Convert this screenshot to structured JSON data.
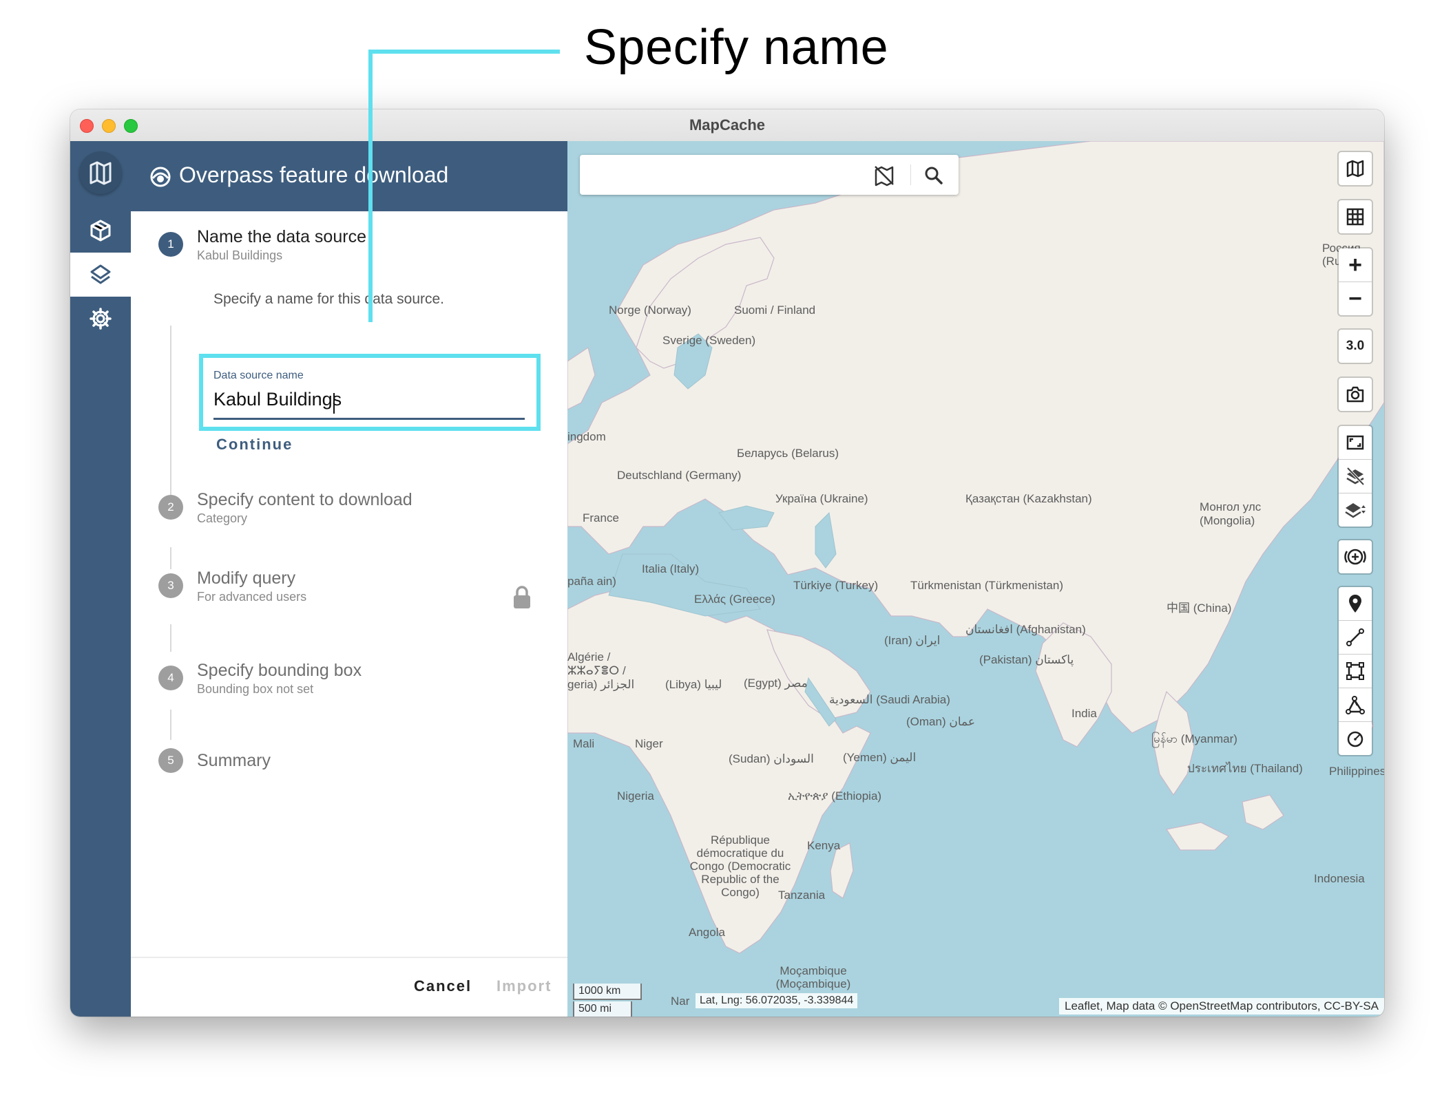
{
  "callout": {
    "text": "Specify name"
  },
  "window": {
    "title": "MapCache"
  },
  "panel": {
    "title": "Overpass feature download",
    "steps": [
      {
        "number": "1",
        "title": "Name the data source",
        "subtitle": "Kabul Buildings"
      },
      {
        "number": "2",
        "title": "Specify content to download",
        "subtitle": "Category"
      },
      {
        "number": "3",
        "title": "Modify query",
        "subtitle": "For advanced users"
      },
      {
        "number": "4",
        "title": "Specify bounding box",
        "subtitle": "Bounding box not set"
      },
      {
        "number": "5",
        "title": "Summary",
        "subtitle": ""
      }
    ],
    "step1_description": "Specify a name for this data source.",
    "field": {
      "label": "Data source name",
      "value": "Kabul Buildings"
    },
    "continue_label": "Continue",
    "cancel_label": "Cancel",
    "import_label": "Import"
  },
  "map": {
    "zoom_level": "3.0",
    "scale_km": "1000 km",
    "scale_mi": "500 mi",
    "lat_lng": "Lat, Lng: 56.072035, -3.339844",
    "attribution": "Leaflet, Map data © OpenStreetMap contributors, CC-BY-SA",
    "labels": [
      "Norge (Norway)",
      "Suomi / Finland",
      "Sverige (Sweden)",
      "ingdom",
      "Беларусь (Belarus)",
      "Deutschland (Germany)",
      "Україна (Ukraine)",
      "France",
      "Қазақстан (Kazakhstan)",
      "Монгол улс (Mongolia)",
      "Italia (Italy)",
      "paña ain)",
      "Türkiye (Turkey)",
      "Ελλάς (Greece)",
      "Türkmenistan (Türkmenistan)",
      "中国 (China)",
      "افغانستان (Afghanistan)",
      "(Iran) ایران",
      "(Pakistan) پاکستان",
      "Algérie / ⵣⵣⴰⵢⴻⵔ / geria) الجزائر",
      "(Libya) ليبيا",
      "(Egypt) مصر",
      "السعودية (Saudi Arabia)",
      "(Oman) عمان",
      "India",
      "မြန်မာ (Myanmar)",
      "ประเทศไทย (Thailand)",
      "Philippines",
      "Mali",
      "Niger",
      "(Sudan) السودان",
      "(Yemen) اليمن",
      "Nigeria",
      "ኢትዮጵያ (Ethiopia)",
      "République démocratique du Congo (Democratic Republic of the Congo)",
      "Kenya",
      "Tanzania",
      "Angola",
      "Moçambique (Moçambique)",
      "Indonesia",
      "Россия (Ru",
      "Nar"
    ]
  },
  "colors": {
    "primary": "#3e5d7e",
    "callout": "#5ee0ef",
    "water": "#aad3df",
    "land": "#f2efe9"
  },
  "icons": {
    "rail": [
      "mapcache-logo-icon",
      "package-icon",
      "layers-icon",
      "gear-icon"
    ],
    "map_tools": [
      "map-icon",
      "grid-icon",
      "zoom-in-icon",
      "zoom-out-icon",
      "camera-icon",
      "fit-extent-icon",
      "layers-off-icon",
      "layers-reorder-icon",
      "add-circle-icon",
      "marker-icon",
      "line-icon",
      "rectangle-icon",
      "polygon-icon",
      "circle-icon"
    ]
  }
}
